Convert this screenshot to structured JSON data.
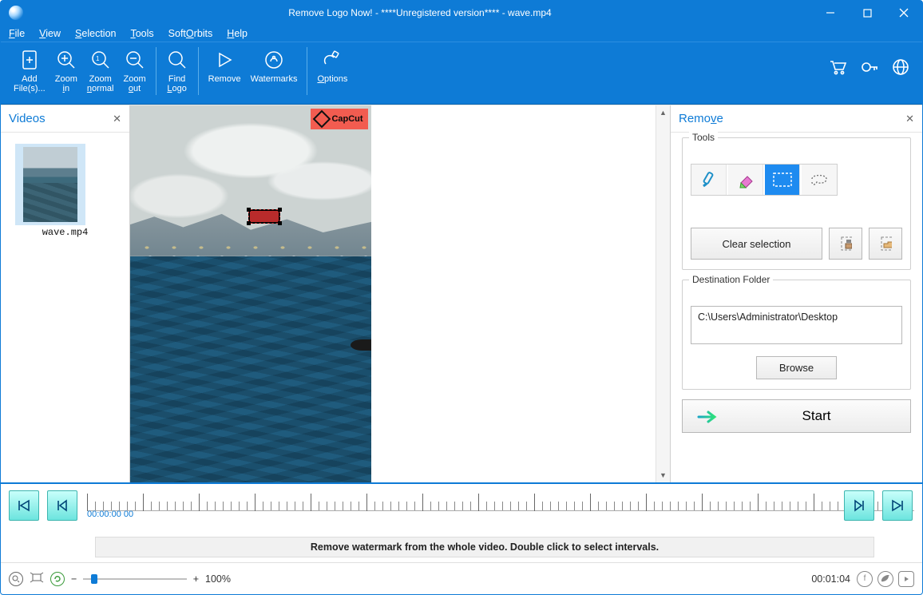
{
  "titlebar": {
    "title": "Remove Logo Now! - ****Unregistered version**** - wave.mp4"
  },
  "menu": {
    "file": "File",
    "view": "View",
    "selection": "Selection",
    "tools": "Tools",
    "softorbits": "SoftOrbits",
    "help": "Help"
  },
  "toolbar": {
    "add": "Add File(s)...",
    "zoom_in": "Zoom in",
    "zoom_normal": "Zoom normal",
    "zoom_out": "Zoom out",
    "find_logo": "Find Logo",
    "remove": "Remove",
    "watermarks": "Watermarks",
    "options": "Options"
  },
  "videos": {
    "title": "Videos",
    "thumb_label": "wave.mp4"
  },
  "preview": {
    "logo_text": "CapCut"
  },
  "remove": {
    "title": "Remove",
    "tools_legend": "Tools",
    "clear": "Clear selection",
    "dest_legend": "Destination Folder",
    "dest_value": "C:\\Users\\Administrator\\Desktop",
    "browse": "Browse",
    "start": "Start"
  },
  "timeline": {
    "pos": "00:00:00 00",
    "hint": "Remove watermark from the whole video. Double click to select intervals."
  },
  "status": {
    "zoom": "100%",
    "time": "00:01:04"
  }
}
